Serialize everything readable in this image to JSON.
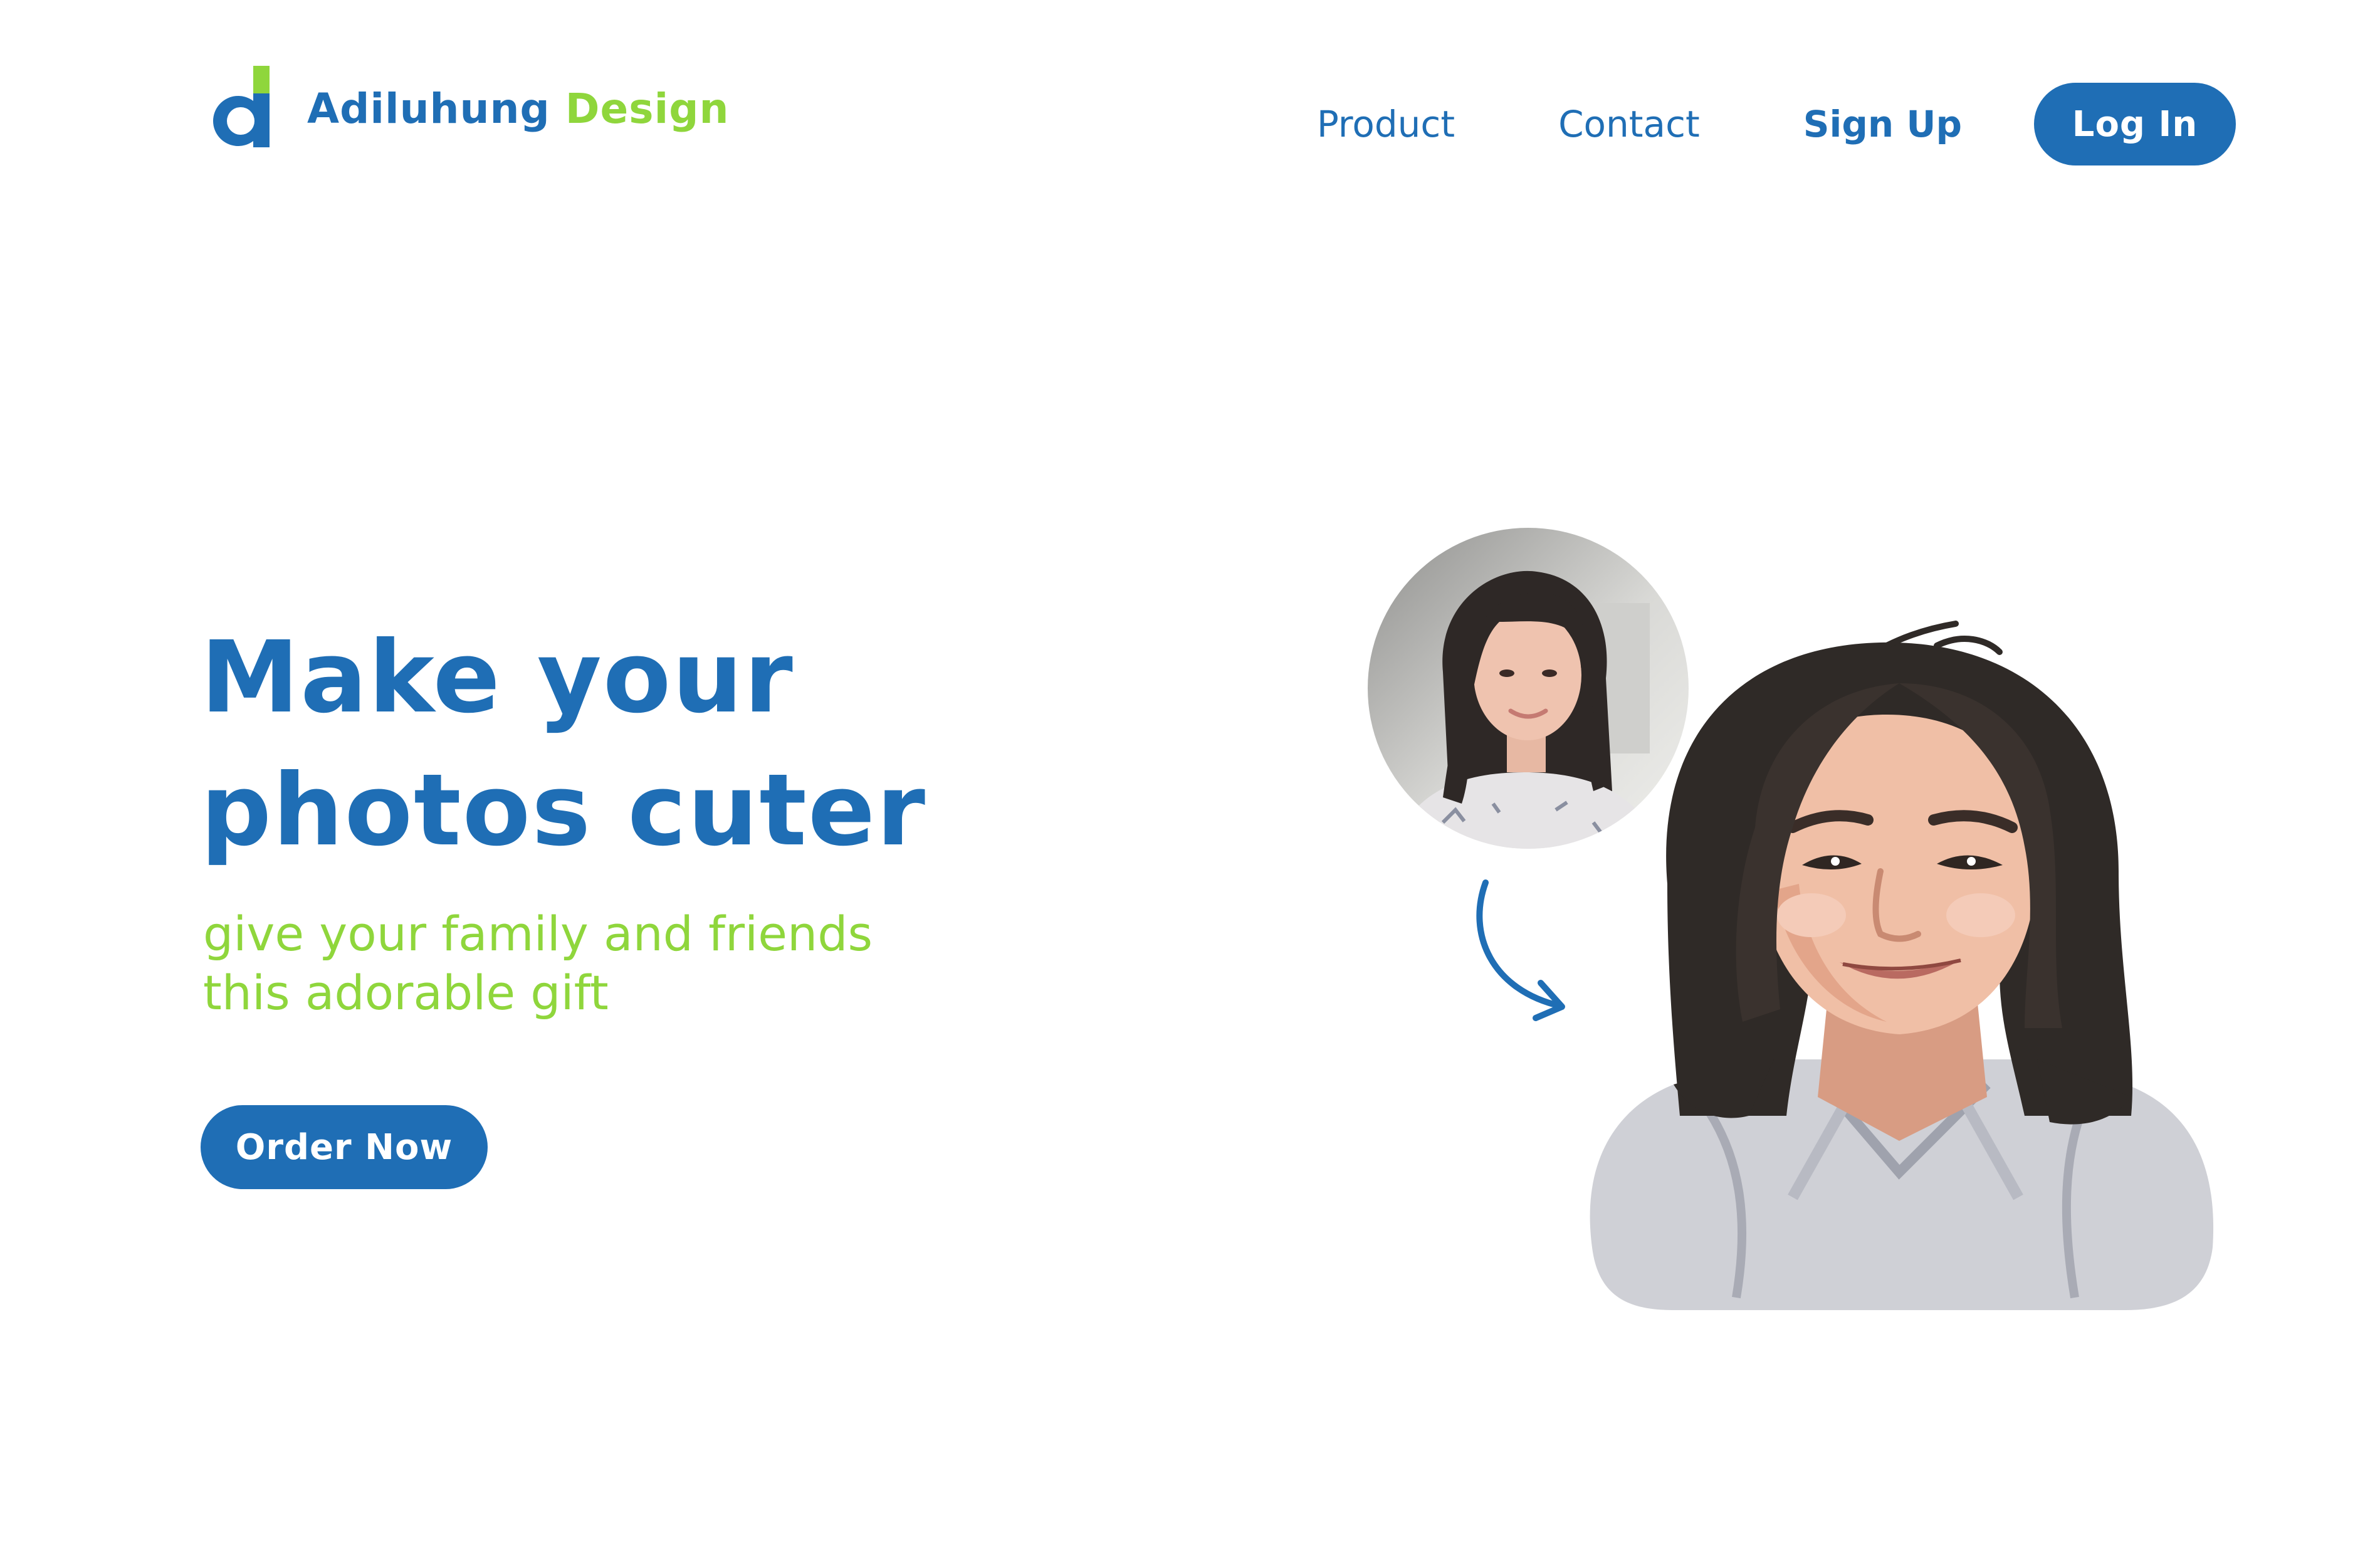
{
  "brand": {
    "name_part1": "Adiluhung",
    "name_part2": "Design",
    "primary_color": "#1f6eb5",
    "accent_color": "#8fd63c"
  },
  "nav": {
    "product": "Product",
    "contact": "Contact",
    "signup": "Sign Up",
    "login": "Log In"
  },
  "hero": {
    "headline_line1": "Make your",
    "headline_line2": "photos cuter",
    "subtitle_line1": "give your family and friends",
    "subtitle_line2": "this adorable gift",
    "cta": "Order Now"
  },
  "illustration": {
    "original_photo_icon": "photo-portrait",
    "arrow_icon": "curved-arrow-icon",
    "result_icon": "vector-portrait"
  }
}
